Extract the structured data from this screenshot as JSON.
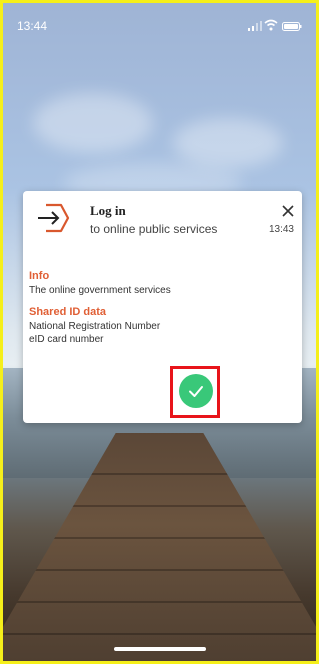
{
  "status_bar": {
    "time": "13:44",
    "signal_icon": "signal-icon",
    "wifi_icon": "wifi-icon",
    "battery_icon": "battery-icon"
  },
  "dialog": {
    "icon": "login-arrow-icon",
    "title": "Log in",
    "subtitle": "to online public services",
    "time": "13:43",
    "close_icon": "close-icon",
    "sections": [
      {
        "heading": "Info",
        "lines": [
          "The online government services"
        ]
      },
      {
        "heading": "Shared ID data",
        "lines": [
          "National Registration Number",
          "eID card number"
        ]
      }
    ],
    "confirm_icon": "check-icon",
    "colors": {
      "accent": "#e05f35",
      "confirm": "#39c879",
      "highlight": "#e8141a",
      "frame": "#f5ef1a"
    }
  }
}
